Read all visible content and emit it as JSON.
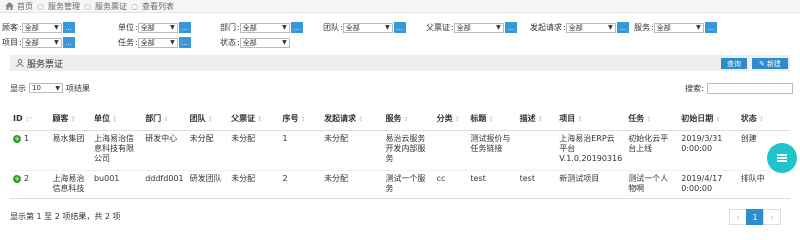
{
  "breadcrumb": [
    "首页",
    "服务管理",
    "服务票证",
    "查看列表"
  ],
  "filters": {
    "customer": {
      "label": "顾客",
      "value": "全部"
    },
    "unit": {
      "label": "单位",
      "value": "全部"
    },
    "department": {
      "label": "部门",
      "value": "全部"
    },
    "team": {
      "label": "团队",
      "value": "全部"
    },
    "parent_ticket": {
      "label": "父票证",
      "value": "全部"
    },
    "request": {
      "label": "发起请求",
      "value": "全部"
    },
    "service": {
      "label": "服务",
      "value": "全部"
    },
    "project": {
      "label": "项目",
      "value": "全部"
    },
    "task": {
      "label": "任务",
      "value": "全部"
    },
    "status": {
      "label": "状态",
      "value": "全部"
    }
  },
  "panel": {
    "title": "服务票证",
    "query_label": "查询",
    "new_label": "新建"
  },
  "list": {
    "show_prefix": "显示",
    "page_size": "10",
    "show_suffix": "项结果",
    "search_label": "搜索:"
  },
  "columns": [
    "ID",
    "顾客",
    "单位",
    "部门",
    "团队",
    "父票证",
    "序号",
    "发起请求",
    "服务",
    "分类",
    "标题",
    "描述",
    "项目",
    "任务",
    "初始日期",
    "状态"
  ],
  "rows": [
    {
      "id": "1",
      "customer": "易水集团",
      "unit": "上海易治信息科技有限公司",
      "department": "研发中心",
      "team": "未分配",
      "parent": "未分配",
      "seq": "1",
      "request": "未分配",
      "service": "易治云服务开发内部服务",
      "category": "",
      "title": "测试报价与任务链接",
      "desc": "",
      "project": "上海易治ERP云平台V.1.0.20190316",
      "task": "初始化云平台上线",
      "date": "2019/3/31 0:00:00",
      "status": "创建"
    },
    {
      "id": "2",
      "customer": "上海易治信息科技",
      "unit": "bu001",
      "department": "dddfd001",
      "team": "研发团队",
      "parent": "未分配",
      "seq": "2",
      "request": "未分配",
      "service": "测试一个服务",
      "category": "cc",
      "title": "test",
      "desc": "test",
      "project": "新测试项目",
      "task": "测试一个人物啊",
      "date": "2019/4/17 0:00:00",
      "status": "排队中"
    }
  ],
  "footer": {
    "info": "显示第 1 至 2 项结果，共 2 项",
    "prev": "‹",
    "page": "1",
    "next": "›"
  },
  "colors": {
    "accent": "#2e8bcc",
    "fab": "#1ec4c9",
    "expand": "#2ca02c"
  }
}
